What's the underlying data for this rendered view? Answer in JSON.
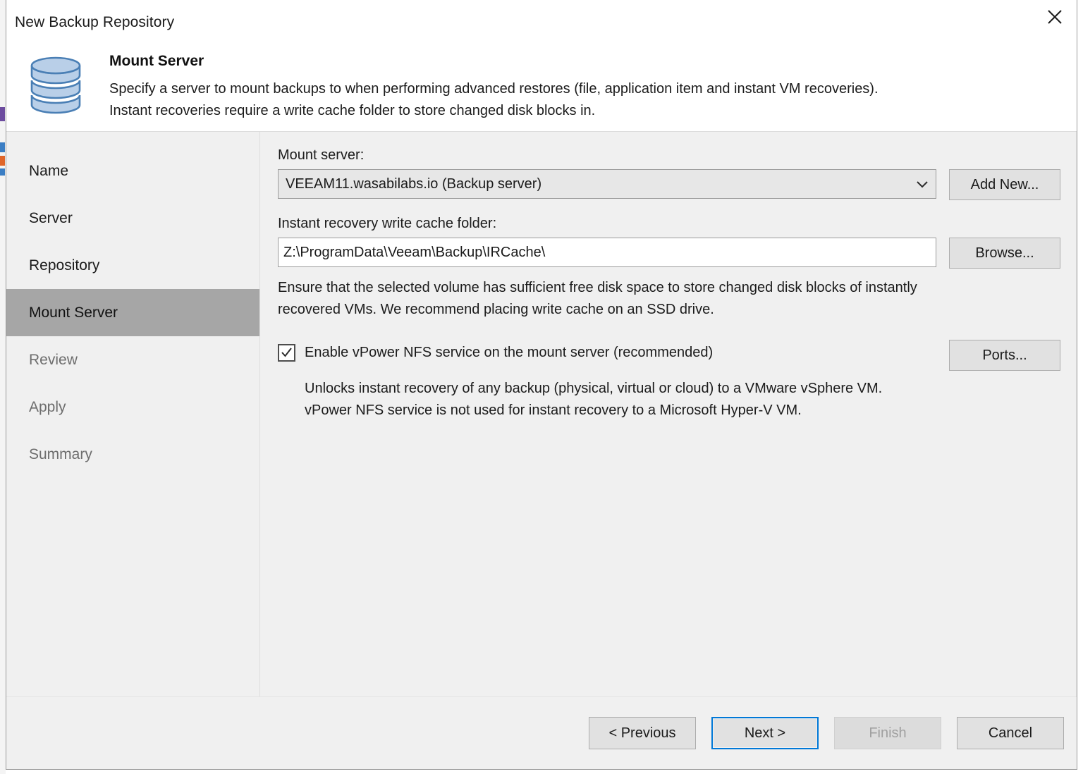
{
  "window": {
    "title": "New Backup Repository",
    "close_label": "✕"
  },
  "header": {
    "icon": "database-icon",
    "title": "Mount Server",
    "description_line1": "Specify a server to mount backups to when performing advanced restores (file, application item and instant VM recoveries).",
    "description_line2": "Instant recoveries require a write cache folder to store changed disk blocks in."
  },
  "sidebar": {
    "items": [
      {
        "label": "Name",
        "state": "done"
      },
      {
        "label": "Server",
        "state": "done"
      },
      {
        "label": "Repository",
        "state": "done"
      },
      {
        "label": "Mount Server",
        "state": "active"
      },
      {
        "label": "Review",
        "state": "future"
      },
      {
        "label": "Apply",
        "state": "future"
      },
      {
        "label": "Summary",
        "state": "future"
      }
    ]
  },
  "main": {
    "mount_server": {
      "label": "Mount server:",
      "value": "VEEAM11.wasabilabs.io (Backup server)",
      "add_new_label": "Add New..."
    },
    "write_cache": {
      "label": "Instant recovery write cache folder:",
      "value": "Z:\\ProgramData\\Veeam\\Backup\\IRCache\\",
      "placeholder": "Z:\\ProgramData\\Veeam\\Backup\\IRCache\\",
      "browse_label": "Browse..."
    },
    "hint_line1": "Ensure that the selected volume has sufficient free disk space to store changed disk blocks of instantly",
    "hint_line2": "recovered VMs. We recommend placing write cache on an SSD drive.",
    "vpower": {
      "checked": true,
      "label": "Enable vPower NFS service on the mount server (recommended)",
      "ports_label": "Ports...",
      "note_line1": "Unlocks instant recovery of any backup (physical, virtual or cloud) to a VMware vSphere VM.",
      "note_line2": "vPower NFS service is not used for instant recovery to a Microsoft Hyper-V VM."
    }
  },
  "footer": {
    "previous_label": "< Previous",
    "next_label": "Next >",
    "finish_label": "Finish",
    "cancel_label": "Cancel"
  },
  "colors": {
    "accent": "#0078d7",
    "dialog_bg": "#f0f0f0",
    "header_bg": "#ffffff",
    "active_nav": "#a6a6a6",
    "icon_fill": "#b9cfe8",
    "icon_stroke": "#4a7fb5"
  }
}
